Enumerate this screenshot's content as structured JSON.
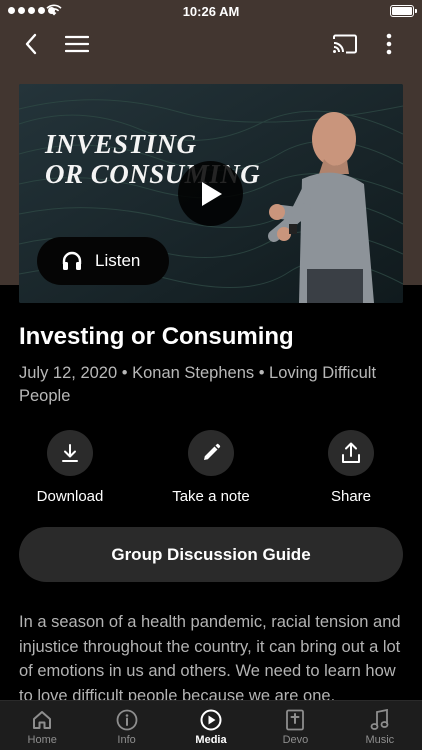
{
  "status_bar": {
    "time": "10:26 AM",
    "battery": 1.0
  },
  "navbar": {
    "back_icon": "chevron-left-icon",
    "menu_icon": "hamburger-icon",
    "cast_icon": "cast-icon",
    "more_icon": "vertical-dots-icon"
  },
  "video": {
    "thumbnail_title_line1": "INVESTING",
    "thumbnail_title_line2": "OR CONSUMING",
    "play_icon": "play-icon",
    "listen_label": "Listen",
    "listen_icon": "headphones-icon"
  },
  "sermon": {
    "title": "Investing or Consuming",
    "meta": "July 12, 2020 • Konan Stephens • Loving Difficult People"
  },
  "actions": [
    {
      "label": "Download",
      "icon": "download-icon"
    },
    {
      "label": "Take a note",
      "icon": "pencil-icon"
    },
    {
      "label": "Share",
      "icon": "share-icon"
    }
  ],
  "guide_button": {
    "label": "Group Discussion Guide"
  },
  "description": "In a season of a health pandemic, racial tension and injustice throughout the country, it can bring out a lot of emotions in us and others. We need to learn how to love difficult people because we are one.",
  "tabs": [
    {
      "label": "Home",
      "icon": "home-icon",
      "active": false
    },
    {
      "label": "Info",
      "icon": "info-icon",
      "active": false
    },
    {
      "label": "Media",
      "icon": "play-circle-icon",
      "active": true
    },
    {
      "label": "Devo",
      "icon": "bible-icon",
      "active": false
    },
    {
      "label": "Music",
      "icon": "music-note-icon",
      "active": false
    }
  ],
  "colors": {
    "header_bg": "#423630",
    "page_bg": "#000000",
    "button_bg": "#2a2a2a",
    "tabbar_bg": "#1d1d1d"
  }
}
